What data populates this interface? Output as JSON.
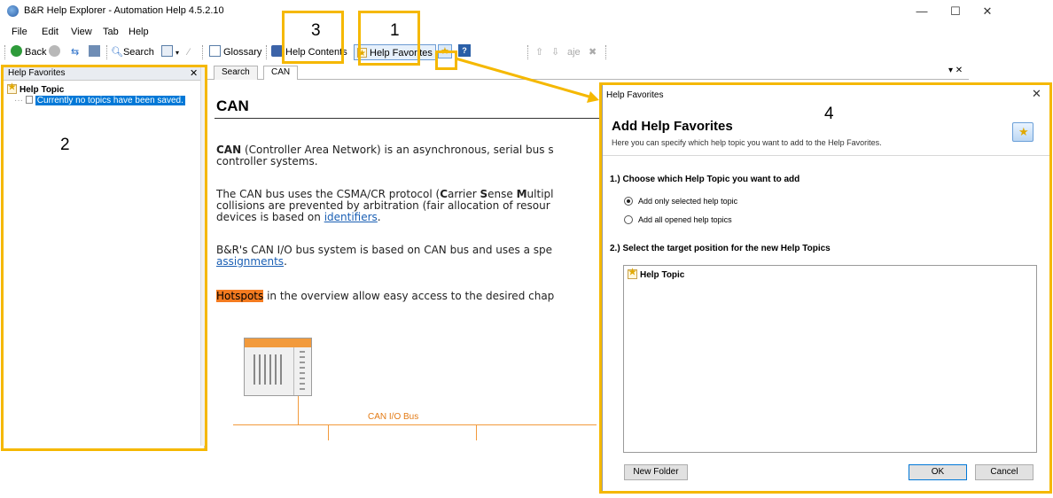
{
  "window": {
    "title": "B&R Help Explorer - Automation Help 4.5.2.10",
    "minimize": "—",
    "maximize": "☐",
    "close": "✕"
  },
  "menu": [
    "File",
    "Edit",
    "View",
    "Tab",
    "Help"
  ],
  "toolbar": {
    "back": "Back",
    "search": "Search",
    "glossary": "Glossary",
    "help_contents": "Help Contents",
    "help_favorites": "Help Favorites",
    "spell_label": "aje"
  },
  "left_panel": {
    "title": "Help Favorites",
    "close": "✕",
    "tree_root": "Help Topic",
    "tree_child": "Currently no topics have been saved."
  },
  "tabs": [
    "Search",
    "CAN"
  ],
  "tab_controls": "▾ ✕",
  "document": {
    "title": "CAN",
    "p1_bold": "CAN",
    "p1_rest": " (Controller Area Network) is an asynchronous, serial bus s",
    "p1_line2": "controller systems.",
    "p2_start": "The CAN bus uses the CSMA/CR protocol (",
    "p2_c": "C",
    "p2_arrier": "arrier ",
    "p2_s": "S",
    "p2_ense": "ense ",
    "p2_m": "M",
    "p2_ultipl": "ultipl",
    "p2_line2": "collisions are prevented by arbitration (fair allocation of resour",
    "p2_line3_start": "devices is based on ",
    "p2_link": "identifiers",
    "p2_line3_end": ".",
    "p3_line1": "B&R's CAN I/O bus system is based on CAN bus and uses a spe",
    "p3_link": "assignments",
    "p3_end": ".",
    "p4_hl": "Hotspots",
    "p4_rest": " in the overview allow easy access to the desired chap",
    "bus_label": "CAN I/O Bus"
  },
  "dialog": {
    "title": "Help Favorites",
    "close": "✕",
    "heading": "Add Help Favorites",
    "subtitle": "Here you can specify which help topic you want to add to the Help Favorites.",
    "section1": "1.) Choose which Help Topic you want to add",
    "radio1": "Add only selected help topic",
    "radio2": "Add all opened help topics",
    "radio_selected": 0,
    "section2": "2.) Select the target position for the new Help Topics",
    "target_item": "Help Topic",
    "new_folder": "New Folder",
    "ok": "OK",
    "cancel": "Cancel"
  },
  "callouts": [
    "1",
    "2",
    "3",
    "4"
  ],
  "colors": {
    "callout": "#f5b800",
    "selection": "#0078d7",
    "highlight": "#f47b20",
    "bus": "#f29a3c",
    "link": "#1a5fb4"
  }
}
